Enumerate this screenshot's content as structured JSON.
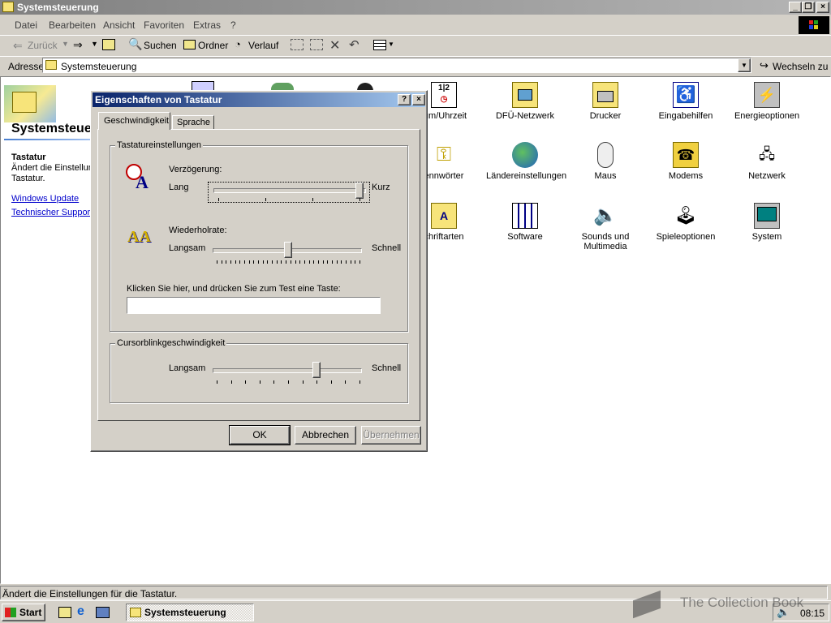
{
  "window": {
    "title": "Systemsteuerung"
  },
  "menu": [
    "Datei",
    "Bearbeiten",
    "Ansicht",
    "Favoriten",
    "Extras",
    "?"
  ],
  "toolbar": {
    "back": "Zurück",
    "search": "Suchen",
    "folders": "Ordner",
    "history": "Verlauf"
  },
  "address": {
    "label": "Adresse",
    "value": "Systemsteuerung",
    "go": "Wechseln zu"
  },
  "left": {
    "heading": "Systemsteuerung",
    "item_title": "Tastatur",
    "item_desc_line1": "Ändert die Einstellun",
    "item_desc_line2": "Tastatur.",
    "links": [
      "Windows Update",
      "Technischer Support"
    ]
  },
  "icons": [
    {
      "label": "tum/Uhrzeit"
    },
    {
      "label": "DFÜ-Netzwerk"
    },
    {
      "label": "Drucker"
    },
    {
      "label": "Eingabehilfen"
    },
    {
      "label": "Energieoptionen"
    },
    {
      "label": "ennwörter"
    },
    {
      "label": "Ländereinstellungen"
    },
    {
      "label": "Maus"
    },
    {
      "label": "Modems"
    },
    {
      "label": "Netzwerk"
    },
    {
      "label": "chriftarten"
    },
    {
      "label": "Software"
    },
    {
      "label": "Sounds und",
      "label2": "Multimedia"
    },
    {
      "label": "Spieleoptionen"
    },
    {
      "label": "System"
    }
  ],
  "dialog": {
    "title": "Eigenschaften von Tastatur",
    "tabs": [
      "Geschwindigkeit",
      "Sprache"
    ],
    "group1": "Tastatureinstellungen",
    "delay_label": "Verzögerung:",
    "delay_left": "Lang",
    "delay_right": "Kurz",
    "delay_value": 1.0,
    "repeat_label": "Wiederholrate:",
    "repeat_left": "Langsam",
    "repeat_right": "Schnell",
    "repeat_value": 0.5,
    "test_label": "Klicken Sie hier, und drücken Sie zum Test eine Taste:",
    "test_value": "",
    "group2": "Cursorblinkgeschwindigkeit",
    "blink_left": "Langsam",
    "blink_right": "Schnell",
    "blink_value": 0.7,
    "ok": "OK",
    "cancel": "Abbrechen",
    "apply": "Übernehmen"
  },
  "statusbar": {
    "text": "Ändert die Einstellungen für die Tastatur."
  },
  "taskbar": {
    "start": "Start",
    "task": "Systemsteuerung",
    "time": "08:15"
  },
  "watermark": "The Collection Book"
}
